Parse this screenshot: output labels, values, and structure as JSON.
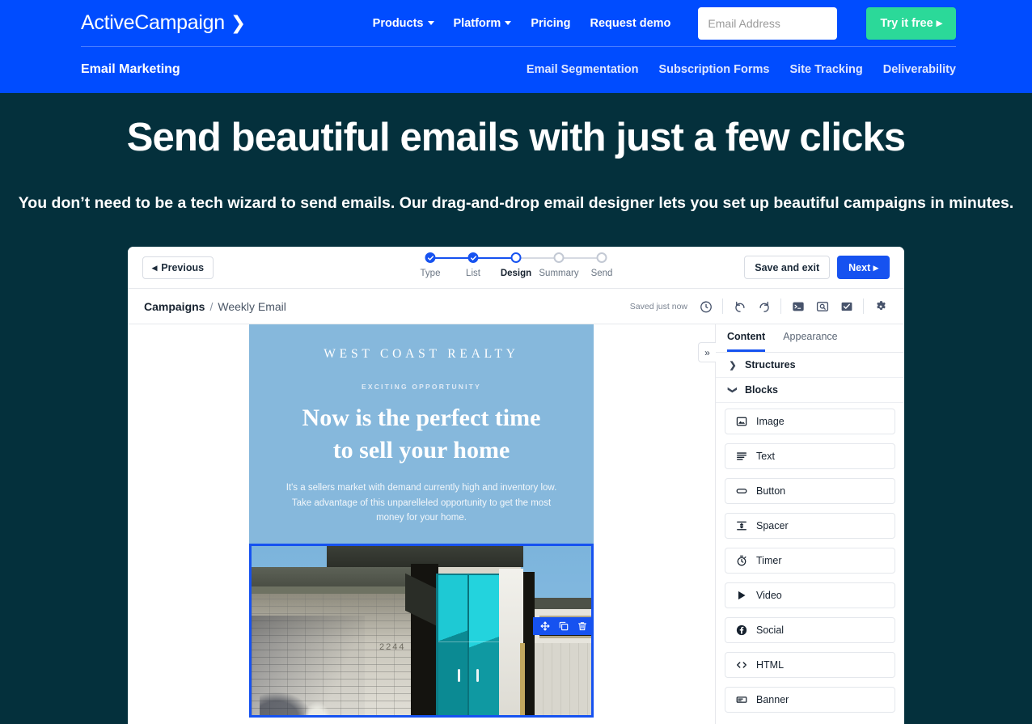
{
  "nav": {
    "brand": "ActiveCampaign",
    "brand_icon": "chevron-right-icon",
    "links": [
      {
        "label": "Products",
        "has_caret": true
      },
      {
        "label": "Platform",
        "has_caret": true
      },
      {
        "label": "Pricing",
        "has_caret": false
      },
      {
        "label": "Request demo",
        "has_caret": false
      }
    ],
    "email_placeholder": "Email Address",
    "email_value": "",
    "cta_label": "Try it free",
    "subnav_title": "Email Marketing",
    "subnav_links": [
      "Email Segmentation",
      "Subscription Forms",
      "Site Tracking",
      "Deliverability"
    ]
  },
  "hero": {
    "heading": "Send beautiful emails with just a few clicks",
    "subheading": "You don’t need to be a tech wizard to send emails. Our drag-and-drop email designer lets you set up beautiful campaigns in minutes."
  },
  "app": {
    "previous_label": "Previous",
    "steps": [
      {
        "label": "Type",
        "state": "done"
      },
      {
        "label": "List",
        "state": "done"
      },
      {
        "label": "Design",
        "state": "active"
      },
      {
        "label": "Summary",
        "state": "todo"
      },
      {
        "label": "Send",
        "state": "todo"
      }
    ],
    "save_exit_label": "Save and exit",
    "next_label": "Next",
    "breadcrumb": {
      "parent": "Campaigns",
      "separator": "/",
      "current": "Weekly Email"
    },
    "saved_status": "Saved just now",
    "toolbar_icons": [
      "revision-history-icon",
      "undo-icon",
      "redo-icon",
      "code-terminal-icon",
      "preview-search-icon",
      "checklist-icon",
      "settings-gear-icon"
    ],
    "collapse_icon": "double-chevron-right-icon"
  },
  "panel": {
    "tabs": [
      {
        "label": "Content",
        "active": true
      },
      {
        "label": "Appearance",
        "active": false
      }
    ],
    "sections": [
      {
        "label": "Structures",
        "expanded": false,
        "icon": "chevron-right-icon"
      },
      {
        "label": "Blocks",
        "expanded": true,
        "icon": "chevron-down-icon"
      }
    ],
    "blocks": [
      {
        "label": "Image",
        "icon": "image-icon"
      },
      {
        "label": "Text",
        "icon": "text-lines-icon"
      },
      {
        "label": "Button",
        "icon": "button-pill-icon"
      },
      {
        "label": "Spacer",
        "icon": "spacer-arrows-icon"
      },
      {
        "label": "Timer",
        "icon": "stopwatch-icon"
      },
      {
        "label": "Video",
        "icon": "play-triangle-icon"
      },
      {
        "label": "Social",
        "icon": "facebook-icon"
      },
      {
        "label": "HTML",
        "icon": "code-brackets-icon"
      },
      {
        "label": "Banner",
        "icon": "banner-icon"
      }
    ]
  },
  "email": {
    "brand": "WEST COAST REALTY",
    "eyebrow": "EXCITING OPPORTUNITY",
    "headline_line1": "Now is the perfect time",
    "headline_line2": "to sell your home",
    "body": "It's a sellers market with demand currently high and inventory low. Take advantage of this unparelleled opportunity to get the most money for your home.",
    "house_number": "2244",
    "block_actions": [
      "move-icon",
      "duplicate-icon",
      "delete-trash-icon"
    ]
  },
  "colors": {
    "brand_blue": "#004CFF",
    "cta_green": "#2BD999",
    "hero_bg": "#04303c",
    "accent_blue": "#1652F0",
    "email_bg": "#86b8dc"
  }
}
